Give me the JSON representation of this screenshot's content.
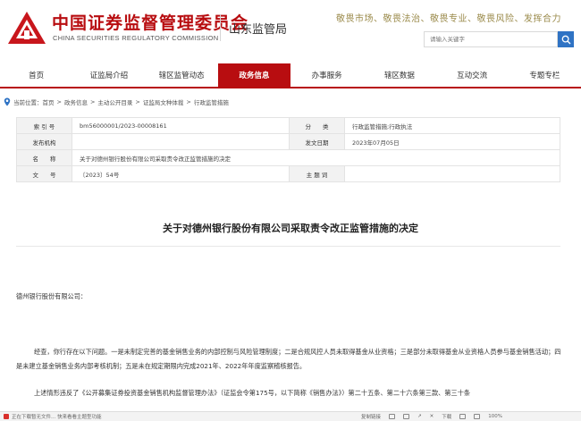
{
  "header": {
    "brand_cn": "中国证券监督管理委员会",
    "brand_en": "CHINA SECURITIES REGULATORY COMMISSION",
    "bureau": "山东监管局",
    "slogan": "敬畏市场、敬畏法治、敬畏专业、敬畏风险、发挥合力",
    "search_placeholder": "请输入关键字",
    "brand_color": "#b80d10"
  },
  "nav": {
    "items": [
      "首页",
      "证监局介绍",
      "辖区监管动态",
      "政务信息",
      "办事服务",
      "辖区数据",
      "互动交流",
      "专题专栏"
    ],
    "active_index": 3
  },
  "breadcrumb": {
    "prefix": "当前位置：",
    "items": [
      "首页",
      "政务信息",
      "主动公开目录",
      "证监局文种体裁",
      "行政监管措施"
    ]
  },
  "info": {
    "index_label": "索 引 号",
    "index_value": "bm56000001/2023-00008161",
    "category_label": "分　　类",
    "category_value": "行政监管措施;行政执法",
    "publisher_label": "发布机构",
    "publisher_value": "",
    "date_label": "发文日期",
    "date_value": "2023年07月05日",
    "name_label": "名　　称",
    "name_value": "关于对德州银行股份有限公司采取责令改正监管措施的决定",
    "docno_label": "文　　号",
    "docno_value": "〔2023〕54号",
    "subject_label": "主 题 词",
    "subject_value": ""
  },
  "doc": {
    "title": "关于对德州银行股份有限公司采取责令改正监管措施的决定",
    "addressee": "德州银行股份有限公司：",
    "para1": "经查，你行存在以下问题。一是未制定完善的基金销售业务的内部控制与风险管理制度；二是合规风控人员未取得基金从业资格；三是部分未取得基金从业资格人员参与基金销售活动；四是未建立基金销售业务内部考核机制；五是未在规定期限内完成2021年、2022年年度监察稽核报告。",
    "para2": "上述情形违反了《公开募集证券投资基金销售机构监督管理办法》（证监会令第175号，以下简称《销售办法》）第二十五条、第二十六条第三款、第三十条"
  },
  "statusbar": {
    "left_text": "正在下载暂无文件...  快来看看主题型功能",
    "right_items": [
      "复制链接",
      "下载",
      "100%"
    ]
  }
}
